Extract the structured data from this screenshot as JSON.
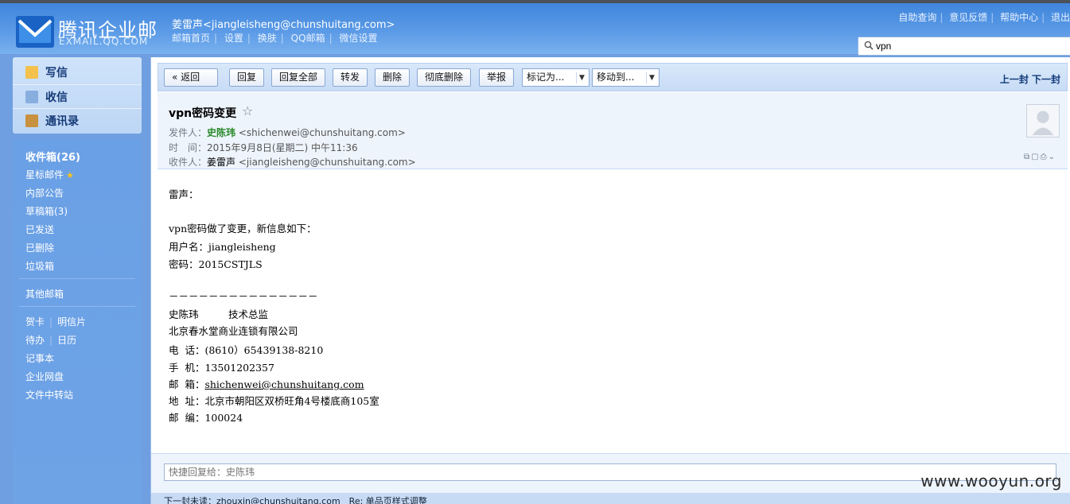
{
  "header": {
    "logo_cn": "腾讯企业邮",
    "logo_en": "EXMAIL.QQ.COM",
    "user": "姜雷声<jiangleisheng@chunshuitang.com>",
    "nav": [
      "邮箱首页",
      "设置",
      "换肤",
      "QQ邮箱",
      "微信设置"
    ],
    "top_links": [
      "自助查询",
      "意见反馈",
      "帮助中心",
      "退出"
    ],
    "search_value": "vpn"
  },
  "sidebar": {
    "top": [
      {
        "label": "写信",
        "color": "#f0c040"
      },
      {
        "label": "收信",
        "color": "#7aa6d8"
      },
      {
        "label": "通讯录",
        "color": "#c89040"
      }
    ],
    "folders": {
      "inbox": "收件箱(26)",
      "starred": "星标邮件",
      "notice": "内部公告",
      "drafts": "草稿箱(3)",
      "sent": "已发送",
      "deleted": "已删除",
      "spam": "垃圾箱",
      "other": "其他邮箱",
      "card": "贺卡",
      "postcard": "明信片",
      "todo": "待办",
      "calendar": "日历",
      "notes": "记事本",
      "disk": "企业网盘",
      "transfer": "文件中转站"
    }
  },
  "toolbar": {
    "back": "« 返回",
    "reply": "回复",
    "reply_all": "回复全部",
    "forward": "转发",
    "delete": "删除",
    "delete_perm": "彻底删除",
    "report": "举报",
    "mark_as": "标记为...",
    "move_to": "移动到...",
    "prev_next": "上一封 下一封"
  },
  "mail": {
    "subject": "vpn密码变更",
    "from_label": "发件人：",
    "from_name": "史陈玮",
    "from_addr": "<shichenwei@chunshuitang.com>",
    "time_label": "时　间：",
    "time": "2015年9月8日(星期二) 中午11:36",
    "to_label": "收件人：",
    "to_name": "姜雷声",
    "to_addr": "<jiangleisheng@chunshuitang.com>",
    "body": {
      "greeting": "雷声：",
      "line1": "vpn密码做了变更，新信息如下：",
      "user": "用户名：jiangleisheng",
      "pwd": "密码：2015CSTJLS",
      "dash": "－－－－－－－－－－－－－－－",
      "sig_name": "史陈玮　　　技术总监",
      "company": "北京春水堂商业连锁有限公司",
      "tel": "电  话：(8610）65439138-8210",
      "mobile": "手  机：13501202357",
      "email_label": "邮  箱：",
      "email": "shichenwei@chunshuitang.com",
      "addr": "地  址：北京市朝阳区双桥旺角4号楼底商105室",
      "zip": "邮  编：100024"
    }
  },
  "reply": {
    "placeholder": "快捷回复给：史陈玮"
  },
  "bottom": {
    "text": "下一封未读：zhouxin@chunshuitang.com　Re: 单品页样式调整"
  },
  "watermark": "www.wooyun.org"
}
